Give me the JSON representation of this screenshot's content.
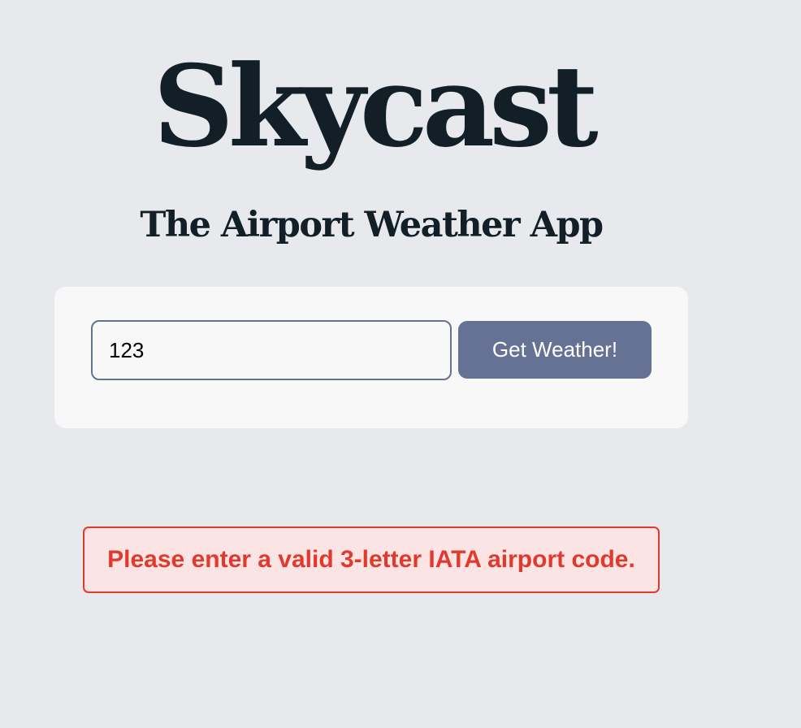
{
  "app": {
    "title": "Skycast",
    "subtitle": "The Airport Weather App"
  },
  "search": {
    "input_value": "123",
    "button_label": "Get Weather!"
  },
  "error": {
    "message": "Please enter a valid 3-letter IATA airport code."
  },
  "colors": {
    "background": "#e8e9ed",
    "title": "#121f27",
    "button": "#667293",
    "error_text": "#e03a2e",
    "error_background": "#fde4e4"
  }
}
